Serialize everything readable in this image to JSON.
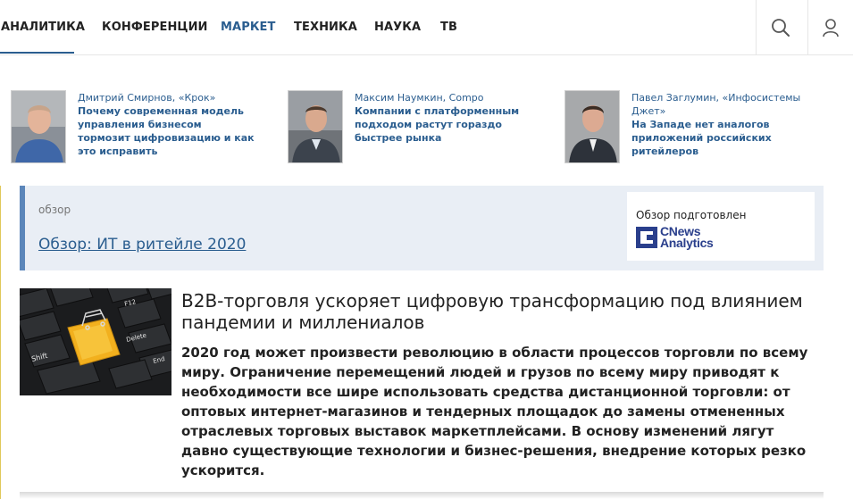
{
  "nav": {
    "items": [
      "АНАЛИТИКА",
      "КОНФЕРЕНЦИИ",
      "МАРКЕТ",
      "ТЕХНИКА",
      "НАУКА",
      "ТВ"
    ],
    "active": "АНАЛИТИКА",
    "highlighted": "МАРКЕТ",
    "icons": [
      "search-icon",
      "user-icon"
    ]
  },
  "experts": [
    {
      "name": "Дмитрий Смирнов, «Крок»",
      "title": "Почему современная модель управления бизнесом тормозит цифровизацию и как это исправить"
    },
    {
      "name": "Максим Наумкин, Compo",
      "title": "Компании с платформенным подходом растут гораздо быстрее рынка"
    },
    {
      "name": "Павел Заглумин, «Инфосистемы Джет»",
      "title": "На Западе нет аналогов приложений российских ритейлеров"
    }
  ],
  "review": {
    "tag": "обзор",
    "link": "Обзор: ИТ в ритейле 2020",
    "sponsor_label": "Обзор подготовлен",
    "sponsor_logo_line1": "CNews",
    "sponsor_logo_line2": "Analytics"
  },
  "article": {
    "title": "B2B-торговля ускоряет цифровую трансформацию под влиянием пандемии и миллениалов",
    "lead": "2020 год может произвести революцию в области процессов торговли по всему миру. Ограничение перемещений людей и грузов по всему миру приводят к необходимости все шире использовать средства дистанционной торговли: от оптовых интернет-магазинов и тендерных площадок до замены отмененных отраслевых торговых выставок маркетплейсами. В основу изменений лягут давно существующие технологии и бизнес-решения, внедрение которых резко ускорится.",
    "image_keys": [
      "Shift",
      "F12",
      "Delete",
      "End"
    ]
  },
  "colors": {
    "link": "#2a5d8f",
    "review_bg": "#e9eef5",
    "review_border": "#5b86ba",
    "logo": "#2a3f8c"
  }
}
